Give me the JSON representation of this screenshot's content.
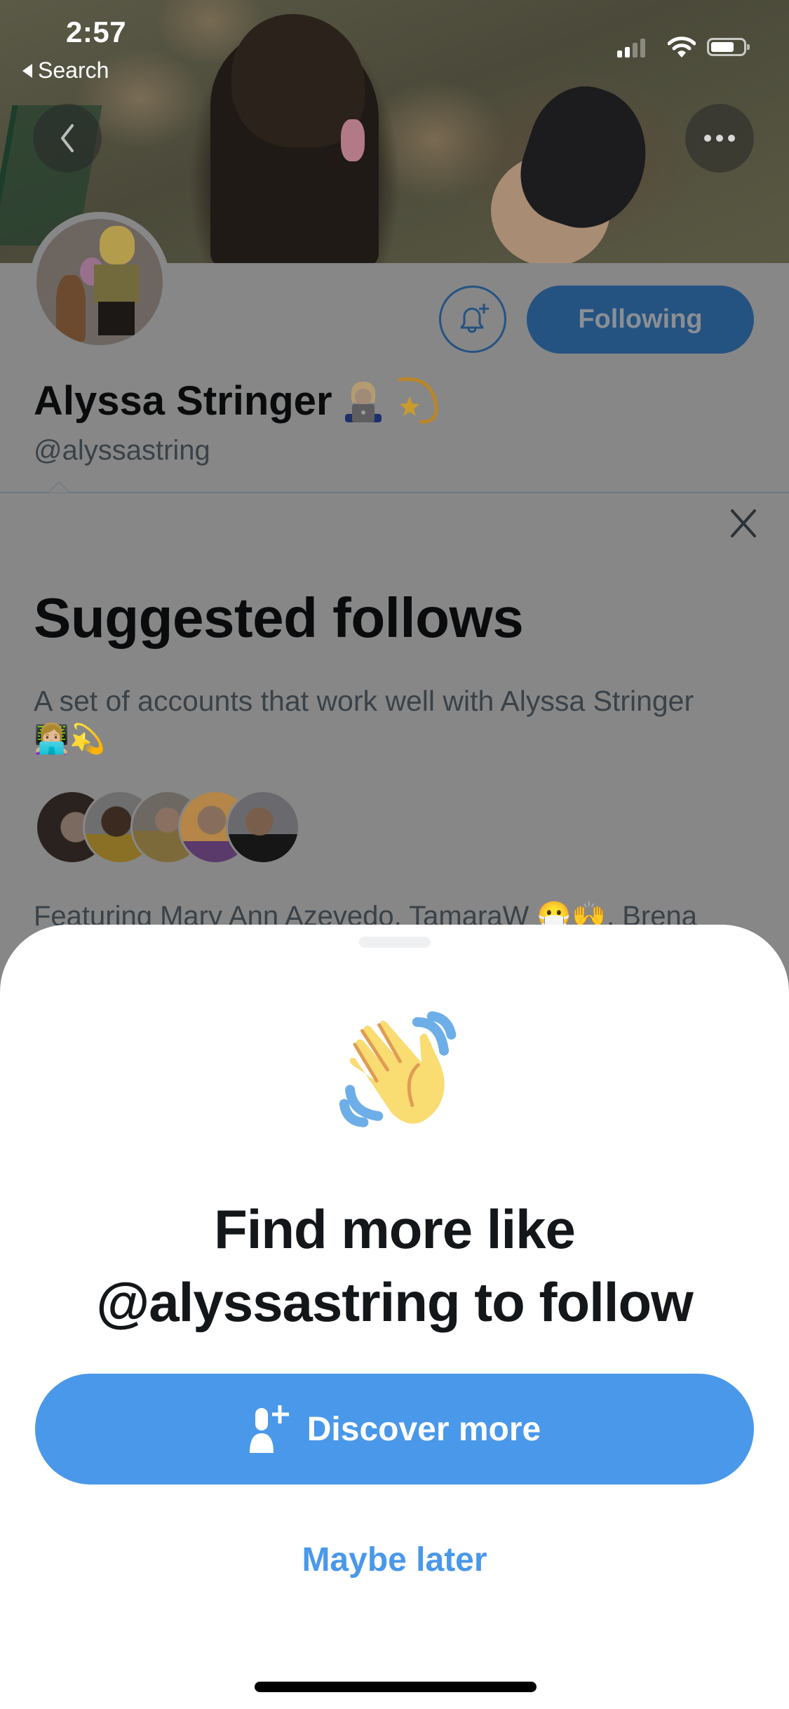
{
  "status_bar": {
    "time": "2:57",
    "back_app_label": "Search",
    "icons": [
      "cellular-signal-icon",
      "wifi-icon",
      "battery-icon"
    ]
  },
  "header": {
    "back_button_icon": "chevron-left-icon",
    "more_button_icon": "more-horizontal-icon"
  },
  "profile": {
    "display_name": "Alyssa Stringer",
    "name_emojis": [
      "👩🏼‍💻",
      "💫"
    ],
    "handle": "@alyssastring",
    "notify_button_icon": "bell-plus-icon",
    "following_label": "Following"
  },
  "suggested": {
    "title": "Suggested follows",
    "description": "A set of accounts that work well with Alyssa Stringer 👩🏼‍💻💫",
    "avatar_count": 5,
    "featuring_text": "Featuring Mary Ann Azevedo, TamaraW 😷🙌, Brena",
    "close_icon": "close-icon"
  },
  "sheet": {
    "illustration": "waving-hand-icon",
    "title_line1": "Find more like",
    "title_line2": "@alyssastring to follow",
    "discover_label": "Discover more",
    "discover_icon": "add-user-icon",
    "maybe_later_label": "Maybe later"
  },
  "colors": {
    "accent": "#4A98E9",
    "accent_dimmed": "#255381",
    "backdrop": "#878787",
    "wave_yellow": "#FADC6F",
    "wave_orange": "#E09C52",
    "wave_blue": "#6EAEE8"
  }
}
